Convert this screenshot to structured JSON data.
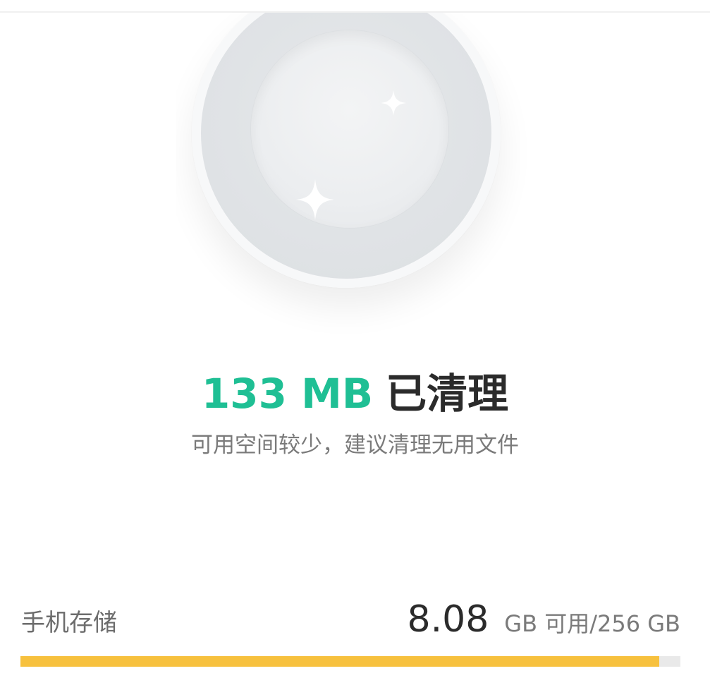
{
  "result": {
    "amount": "133 MB",
    "status": "已清理",
    "amount_color": "#1fbf94",
    "subtitle": "可用空间较少，建议清理无用文件"
  },
  "illustration": {
    "icon": "empty-bowl-sparkle-icon"
  },
  "storage": {
    "label": "手机存储",
    "free_value": "8.08",
    "free_unit_text": "GB 可用/256 GB",
    "used_fraction": 0.9684,
    "bar_color": "#f7c13e",
    "track_color": "#e9e9e9"
  }
}
